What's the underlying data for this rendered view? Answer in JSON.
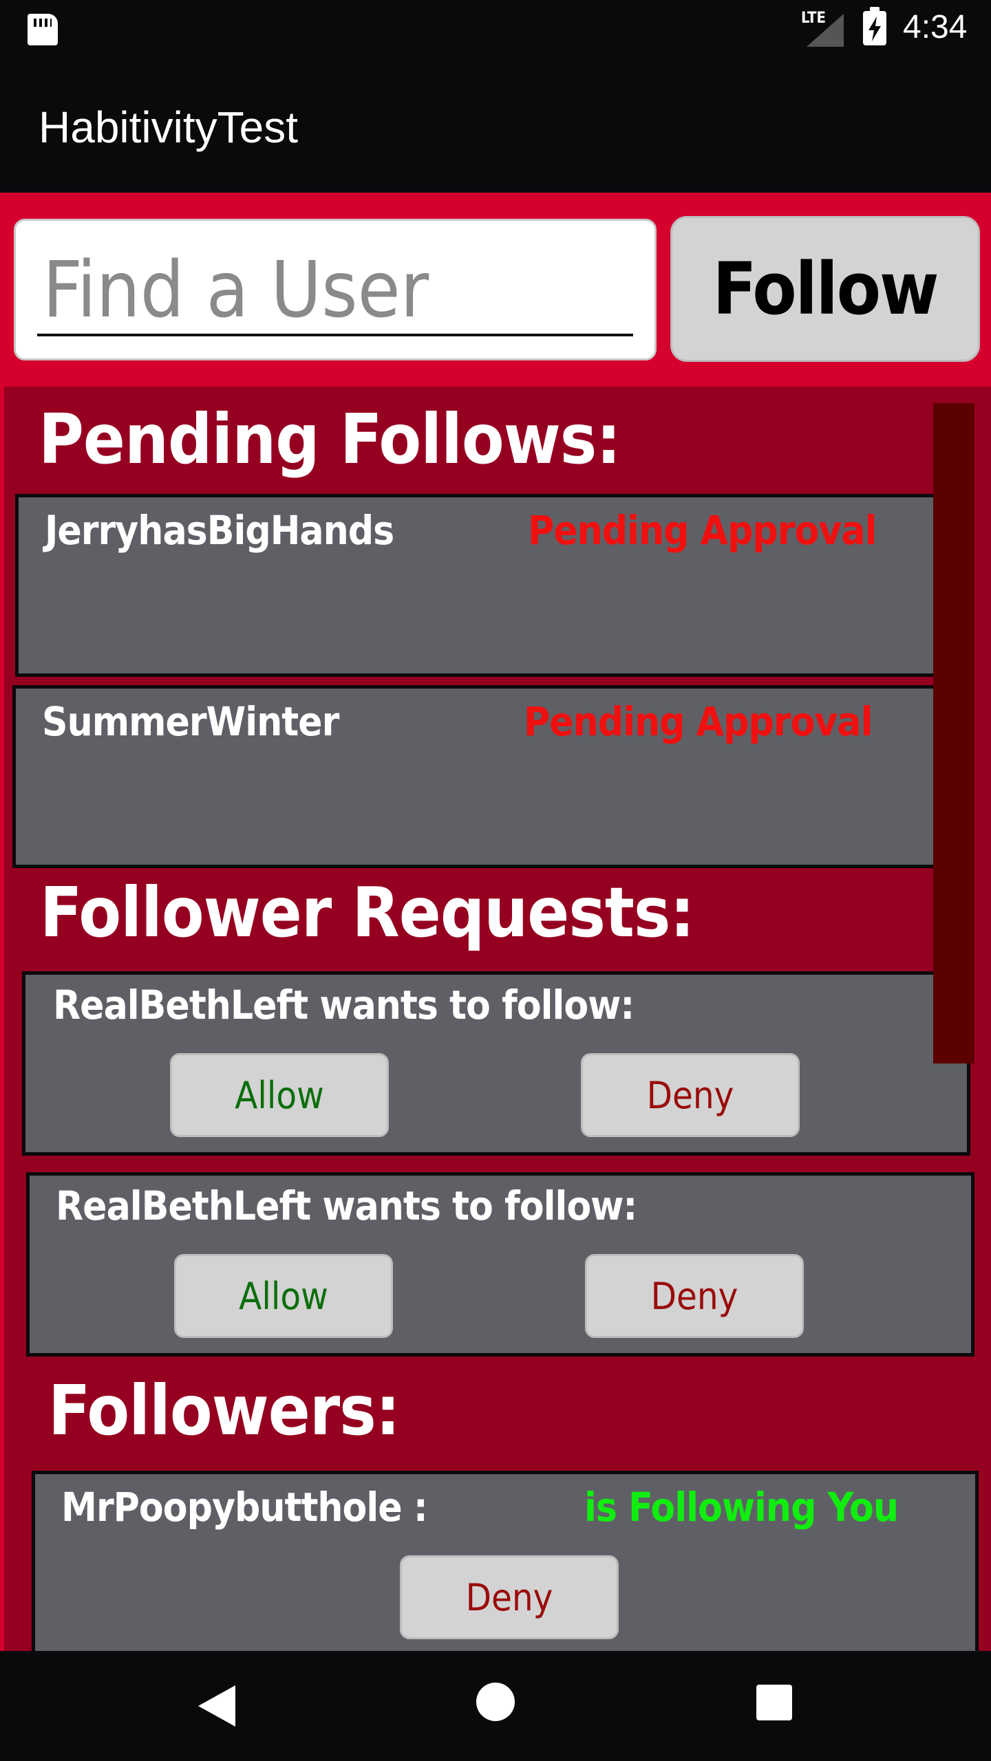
{
  "status_bar": {
    "time": "4:34",
    "network": "LTE",
    "icons": [
      "sd-card-icon",
      "signal-icon",
      "battery-charging-icon"
    ]
  },
  "app_bar": {
    "title": "HabitivityTest"
  },
  "search": {
    "placeholder": "Find a User",
    "value": ""
  },
  "follow_button": {
    "label": "Follow"
  },
  "pending_follows": {
    "title": "Pending Follows:",
    "items": [
      {
        "username": "JerryhasBigHands",
        "status": "Pending Approval"
      },
      {
        "username": "SummerWinter",
        "status": "Pending Approval"
      }
    ]
  },
  "follower_requests": {
    "title": "Follower Requests:",
    "items": [
      {
        "text": "RealBethLeft wants to follow:",
        "allow_label": "Allow",
        "deny_label": "Deny"
      },
      {
        "text": "RealBethLeft wants to follow:",
        "allow_label": "Allow",
        "deny_label": "Deny"
      }
    ]
  },
  "followers": {
    "title": "Followers:",
    "items": [
      {
        "username": "MrPoopybutthole :",
        "status": "is Following You",
        "deny_label": "Deny"
      }
    ]
  },
  "colors": {
    "accent": "#d6002e",
    "list_background": "#960020",
    "card": "#5f6066",
    "pending": "#f01010",
    "following": "#10ee10",
    "allow": "#0a6e0a",
    "deny": "#9a0a0a"
  },
  "nav_bar": {
    "icons": [
      "back-icon",
      "home-icon",
      "recents-icon"
    ]
  }
}
